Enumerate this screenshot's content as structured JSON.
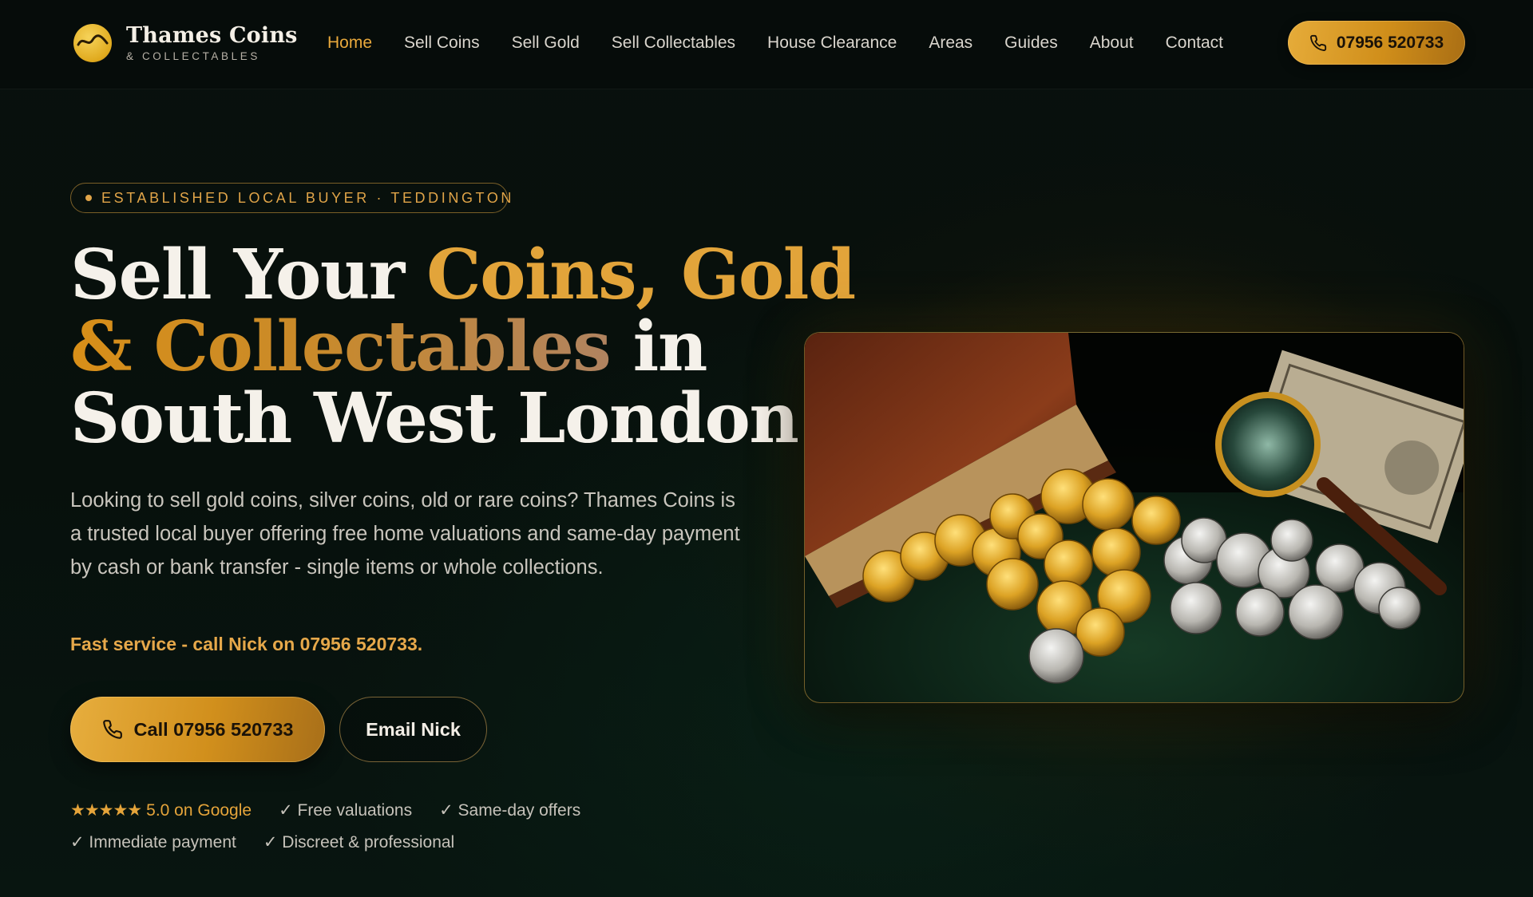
{
  "brand": {
    "title": "Thames Coins",
    "subtitle": "& COLLECTABLES"
  },
  "nav": {
    "items": [
      {
        "label": "Home",
        "active": true
      },
      {
        "label": "Sell Coins",
        "active": false
      },
      {
        "label": "Sell Gold",
        "active": false
      },
      {
        "label": "Sell Collectables",
        "active": false
      },
      {
        "label": "House Clearance",
        "active": false
      },
      {
        "label": "Areas",
        "active": false
      },
      {
        "label": "Guides",
        "active": false
      },
      {
        "label": "About",
        "active": false
      },
      {
        "label": "Contact",
        "active": false
      }
    ],
    "phone_label": "07956 520733",
    "phone_icon": "phone-icon"
  },
  "hero": {
    "badge": "ESTABLISHED LOCAL BUYER · TEDDINGTON",
    "headline": {
      "part1": "Sell Your ",
      "part2_gold": "Coins, Gold",
      "part3_gold": "& Collectables",
      "part4": " in",
      "part5": "South West London"
    },
    "intro": "Looking to sell gold coins, silver coins, old or rare coins? Thames Coins is a trusted local buyer offering free home valuations and same-day payment by cash or bank transfer - single items or whole collections.",
    "fast_service": "Fast service - call Nick on 07956 520733.",
    "cta_call": "Call 07956 520733",
    "cta_email": "Email Nick",
    "rating_stars": "★★★★★",
    "rating_text": "5.0 on Google",
    "trust": {
      "free_valuations": "✓ Free valuations",
      "same_day_offers": "✓ Same-day offers",
      "immediate_payment": "✓ Immediate payment",
      "discreet": "✓ Discreet & professional"
    }
  },
  "colors": {
    "accent_gold": "#e2a43a",
    "background": "#070d0a",
    "text_light": "#f5f1ea"
  }
}
